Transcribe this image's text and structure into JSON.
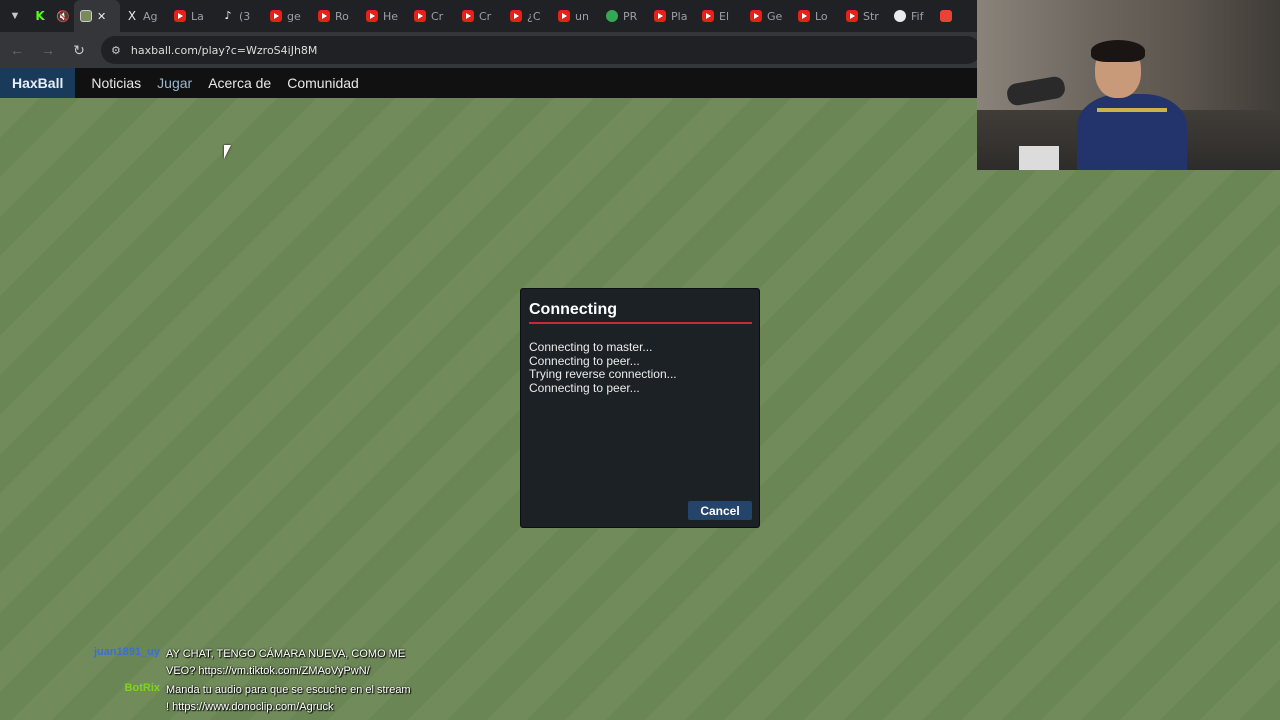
{
  "browser": {
    "tabs": [
      {
        "icon": "kick-icon",
        "label": ""
      },
      {
        "icon": "mute-icon",
        "label": ""
      },
      {
        "icon": "haxball-icon",
        "label": "",
        "active": true
      },
      {
        "icon": "x-icon",
        "label": "Ag"
      },
      {
        "icon": "youtube-icon",
        "label": "La"
      },
      {
        "icon": "tiktok-icon",
        "label": "(3"
      },
      {
        "icon": "youtube-icon",
        "label": "ge"
      },
      {
        "icon": "youtube-icon",
        "label": "Ro"
      },
      {
        "icon": "youtube-icon",
        "label": "He"
      },
      {
        "icon": "youtube-icon",
        "label": "Cr"
      },
      {
        "icon": "youtube-icon",
        "label": "Cr"
      },
      {
        "icon": "youtube-icon",
        "label": "¿C"
      },
      {
        "icon": "youtube-icon",
        "label": "un"
      },
      {
        "icon": "green-circle-icon",
        "label": "PR"
      },
      {
        "icon": "youtube-icon",
        "label": "Pla"
      },
      {
        "icon": "youtube-icon",
        "label": "El"
      },
      {
        "icon": "youtube-icon",
        "label": "Ge"
      },
      {
        "icon": "youtube-icon",
        "label": "Lo"
      },
      {
        "icon": "youtube-icon",
        "label": "Str"
      },
      {
        "icon": "circle-icon",
        "label": "Fif"
      },
      {
        "icon": "gmail-icon",
        "label": ""
      }
    ],
    "url": "haxball.com/play?c=WzroS4iJh8M"
  },
  "site_nav": {
    "brand": "HaxBall",
    "links": [
      "Noticias",
      "Jugar",
      "Acerca de",
      "Comunidad"
    ],
    "current": "Jugar"
  },
  "dialog": {
    "title": "Connecting",
    "log": [
      "Connecting to master...",
      "Connecting to peer...",
      "Trying reverse connection...",
      "Connecting to peer..."
    ],
    "cancel_label": "Cancel"
  },
  "chat": [
    {
      "user": "juan1891_uy",
      "text": "AY CHAT, TENGO CÁMARA NUEVA, COMO ME VEO? https://vm.tiktok.com/ZMAoVyPwN/",
      "color": "#3b6fd1"
    },
    {
      "user": "BotRix",
      "text": "Manda tu audio para que se escuche en el stream ! https://www.donoclip.com/Agruck",
      "color": "#7ed321"
    }
  ],
  "colors": {
    "pitch": "#718c5a",
    "dialog_bg": "#1b2125",
    "accent_line": "#c9273a",
    "button": "#244569"
  }
}
